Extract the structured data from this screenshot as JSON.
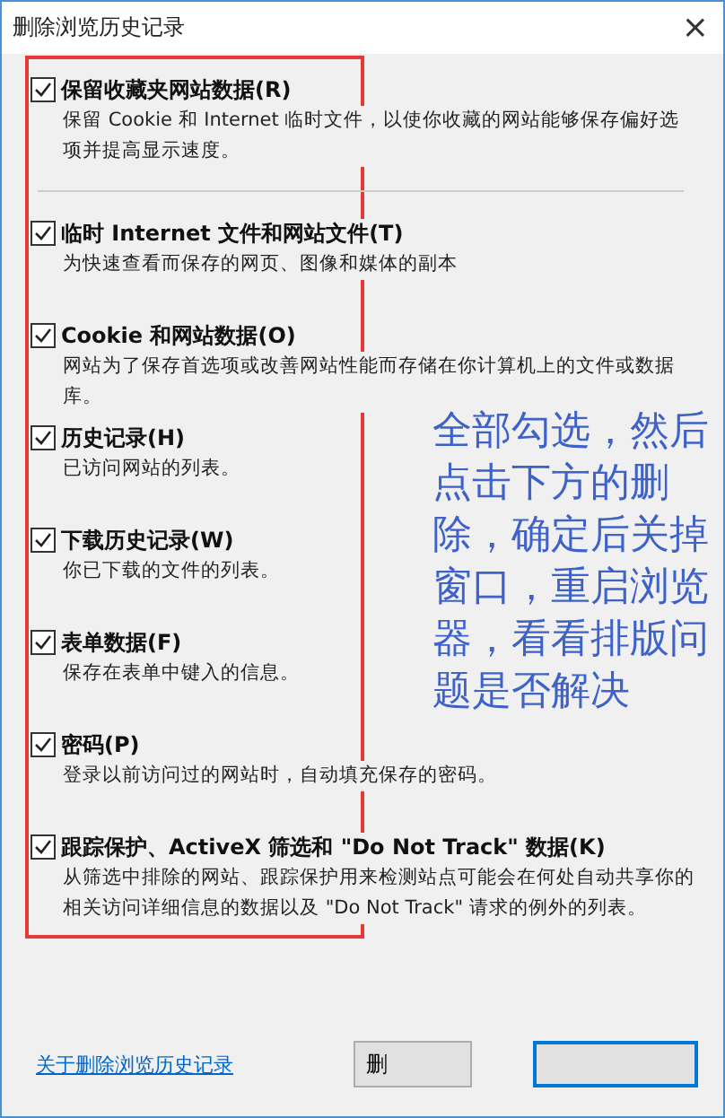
{
  "window": {
    "title": "删除浏览历史记录",
    "close": "×"
  },
  "items": [
    {
      "label": "保留收藏夹网站数据(R)",
      "description": "保留 Cookie 和 Internet 临时文件，以使你收藏的网站能够保存偏好选项并提高显示速度。",
      "checked": true
    },
    {
      "label": "临时 Internet 文件和网站文件(T)",
      "description": "为快速查看而保存的网页、图像和媒体的副本",
      "checked": true
    },
    {
      "label": "Cookie 和网站数据(O)",
      "description": "网站为了保存首选项或改善网站性能而存储在你计算机上的文件或数据库。",
      "checked": true
    },
    {
      "label": "历史记录(H)",
      "description": "已访问网站的列表。",
      "checked": true
    },
    {
      "label": "下载历史记录(W)",
      "description": "你已下载的文件的列表。",
      "checked": true
    },
    {
      "label": "表单数据(F)",
      "description": "保存在表单中键入的信息。",
      "checked": true
    },
    {
      "label": "密码(P)",
      "description": "登录以前访问过的网站时，自动填充保存的密码。",
      "checked": true
    },
    {
      "label": "跟踪保护、ActiveX 筛选和 \"Do Not Track\" 数据(K)",
      "description": "从筛选中排除的网站、跟踪保护用来检测站点可能会在何处自动共享你的相关访问详细信息的数据以及 \"Do Not Track\" 请求的例外的列表。",
      "checked": true
    }
  ],
  "link": "关于删除浏览历史记录",
  "buttons": [
    {
      "label": "删",
      "default": false
    },
    {
      "default": true
    }
  ],
  "annotation": {
    "lines": [
      "全部勾选，然后",
      "点击下方的删",
      "除，确定后关掉",
      "窗口，重启浏览",
      "器，看看排版问",
      "题是否解决"
    ]
  }
}
